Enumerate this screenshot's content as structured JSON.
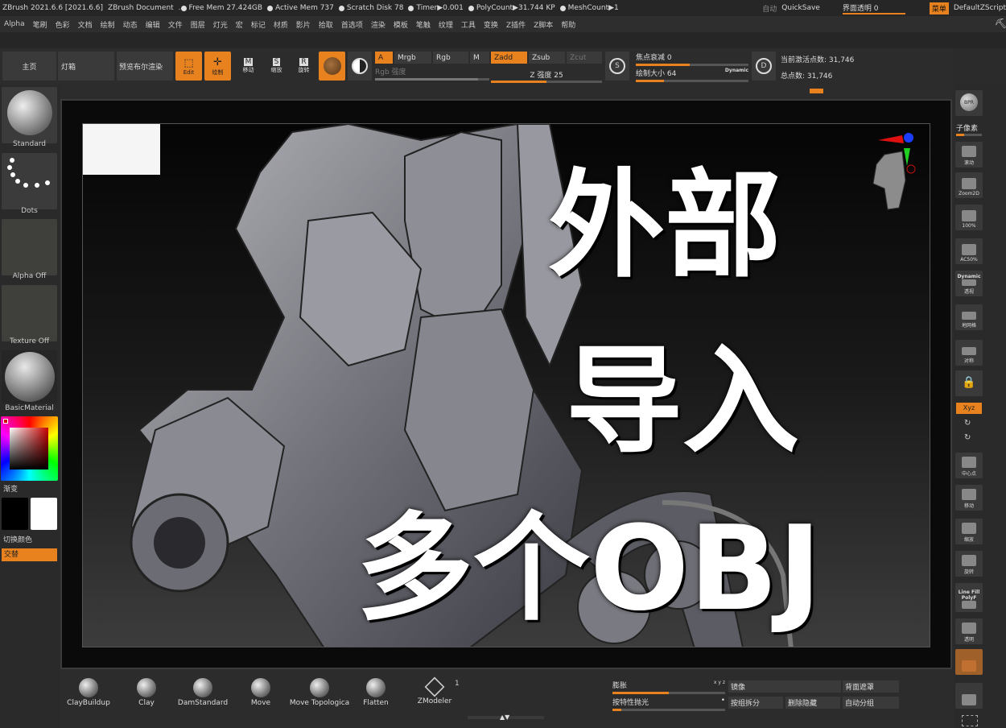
{
  "titlebar": {
    "app": "ZBrush 2021.6.6 [2021.6.6]",
    "doc": "ZBrush Document",
    "free_mem": "Free Mem 27.424GB",
    "active_mem": "Active Mem 737",
    "scratch": "Scratch Disk 78",
    "timer": "Timer▶0.001",
    "polycount": "PolyCount▶31.744 KP",
    "meshcount": "MeshCount▶1",
    "auto": "自动",
    "quicksave": "QuickSave",
    "transparency": "界面透明 0",
    "menu": "菜单",
    "script": "DefaultZScript"
  },
  "menu": [
    "Alpha",
    "笔刷",
    "色彩",
    "文档",
    "绘制",
    "动态",
    "编辑",
    "文件",
    "图层",
    "灯光",
    "宏",
    "标记",
    "材质",
    "影片",
    "拾取",
    "首选项",
    "渲染",
    "模板",
    "笔触",
    "纹理",
    "工具",
    "变换",
    "Z插件",
    "Z脚本",
    "帮助"
  ],
  "toolbar": {
    "home": "主页",
    "lightbox": "灯箱",
    "preview": "预览布尔渲染",
    "edit": "Edit",
    "draw": "绘制",
    "move": "移动",
    "scale": "缩放",
    "rotate": "旋转",
    "A": "A",
    "mrgb": "Mrgb",
    "rgb": "Rgb",
    "m": "M",
    "zadd": "Zadd",
    "zsub": "Zsub",
    "zcut": "Zcut",
    "rgb_intensity": "Rgb 强度",
    "z_intensity": "Z 强度 25",
    "focal": "焦点衰减 0",
    "draw_size": "绘制大小 64",
    "dynamic": "Dynamic",
    "active_points": "当前激活点数: 31,746",
    "total_points": "总点数: 31,746",
    "icon_s": "S",
    "icon_d": "D"
  },
  "leftpanel": {
    "standard": "Standard",
    "dots": "Dots",
    "alpha_off": "Alpha Off",
    "texture_off": "Texture Off",
    "material": "BasicMaterial",
    "gradient": "渐变",
    "switch_color": "切换颜色",
    "alternate": "交替"
  },
  "overlay": {
    "line1": "外部",
    "line2": "导入",
    "line3": "多个OBJ"
  },
  "rightpanel": [
    "BPR",
    "子像素",
    "滚动",
    "Zoom2D",
    "100%",
    "AC50%",
    "Dynamic",
    "透视",
    "地网格",
    "对称",
    "",
    "Xyz",
    "",
    "",
    "中心点",
    "移动",
    "缩放",
    "旋转",
    "Line Fill PolyF",
    "透明",
    "",
    ""
  ],
  "brushes": [
    "ClayBuildup",
    "Clay",
    "DamStandard",
    "Move",
    "Move Topologica",
    "Flatten",
    "ZModeler"
  ],
  "zmodeler_count": "1",
  "bottom_right": {
    "inflate": "膨胀",
    "mirror": "镜像",
    "backface": "背面遮罩",
    "feature_polish": "按特性抛光",
    "split_group": "按组拆分",
    "delete_hidden": "删除隐藏",
    "auto_group": "自动分组",
    "xyz": "x y z"
  }
}
